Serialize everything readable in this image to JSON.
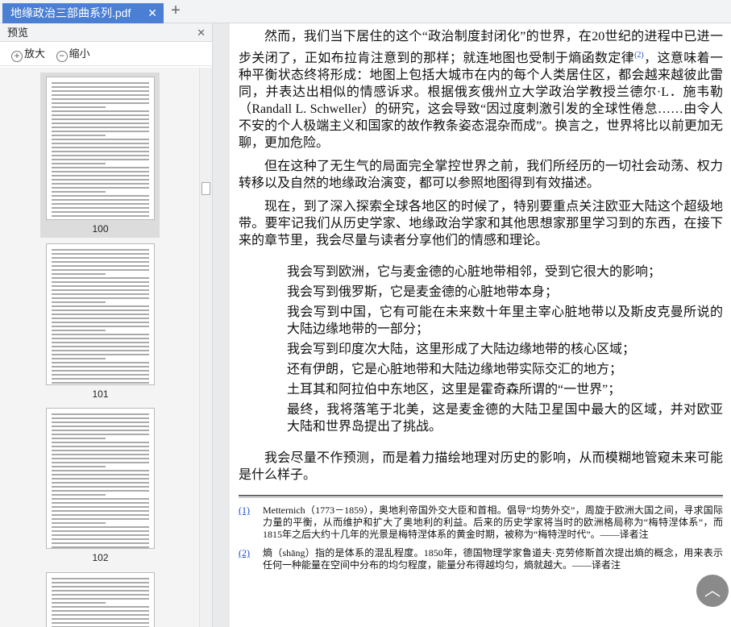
{
  "tabs": [
    {
      "label": "地缘政治三部曲系列.pdf"
    }
  ],
  "sidebar": {
    "title": "预览",
    "zoom_in": "放大",
    "zoom_out": "缩小",
    "pages": [
      "100",
      "101",
      "102"
    ]
  },
  "content": {
    "paragraphs": [
      "然而，我们当下居住的这个“政治制度封闭化”的世界，在20世纪的进程中已进一步关闭了，正如布拉肯注意到的那样；就连地图也受制于熵函数定律",
      "，这意味着一种平衡状态终将形成：地图上包括大城市在内的每个人类居住区，都会越来越彼此雷同，并表达出相似的情感诉求。根据俄亥俄州立大学政治学教授兰德尔·L．施韦勒（Randall L. Schweller）的研究，这会导致“因过度刺激引发的全球性倦怠……由令人不安的个人极端主义和国家的故作教条姿态混杂而成”。换言之，世界将比以前更加无聊，更加危险。",
      "但在这种了无生气的局面完全掌控世界之前，我们所经历的一切社会动荡、权力转移以及自然的地缘政治演变，都可以参照地图得到有效描述。",
      "现在，到了深入探索全球各地区的时候了，特别要重点关注欧亚大陆这个超级地带。要牢记我们从历史学家、地缘政治学家和其他思想家那里学习到的东西，在接下来的章节里，我会尽量与读者分享他们的情感和理论。"
    ],
    "footnote_ref": "(2)",
    "verses": [
      "我会写到欧洲，它与麦金德的心脏地带相邻，受到它很大的影响；",
      "我会写到俄罗斯，它是麦金德的心脏地带本身；",
      "我会写到中国，它有可能在未来数十年里主宰心脏地带以及斯皮克曼所说的大陆边缘地带的一部分；",
      "我会写到印度次大陆，这里形成了大陆边缘地带的核心区域；",
      "还有伊朗，它是心脏地带和大陆边缘地带实际交汇的地方；",
      "土耳其和阿拉伯中东地区，这里是霍奇森所谓的“一世界”；",
      "最终，我将落笔于北美，这是麦金德的大陆卫星国中最大的区域，并对欧亚大陆和世界岛提出了挑战。"
    ],
    "closing": "我会尽量不作预测，而是着力描绘地理对历史的影响，从而模糊地管窥未来可能是什么样子。",
    "footnotes": [
      {
        "ref": "(1)",
        "text": "Metternich（1773－1859），奥地利帝国外交大臣和首相。倡导“均势外交”，周旋于欧洲大国之间，寻求国际力量的平衡，从而维护和扩大了奥地利的利益。后来的历史学家将当时的欧洲格局称为“梅特涅体系”，而1815年之后大约十几年的光景是梅特涅体系的黄金时期，被称为“梅特涅时代”。——译者注"
      },
      {
        "ref": "(2)",
        "text": "熵（shāng）指的是体系的混乱程度。1850年，德国物理学家鲁道夫·克劳修斯首次提出熵的概念，用来表示任何一种能量在空间中分布的均匀程度，能量分布得越均匀，熵就越大。——译者注"
      }
    ]
  }
}
